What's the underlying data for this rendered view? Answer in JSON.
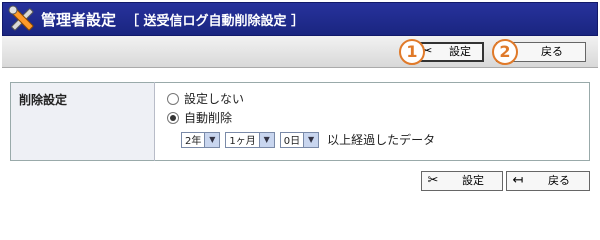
{
  "header": {
    "title": "管理者設定",
    "subtitle": "［ 送受信ログ自動削除設定 ］",
    "icon": "tools-icon"
  },
  "toolbar": {
    "set_label": "設定",
    "back_label": "戻る",
    "badge_1": "1",
    "badge_2": "2"
  },
  "form": {
    "row_label": "削除設定",
    "option_no": "設定しない",
    "option_auto": "自動削除",
    "selected_option": "自動削除",
    "year_value": "2年",
    "month_value": "1ヶ月",
    "day_value": "0日",
    "suffix": "以上経過したデータ"
  },
  "footer": {
    "set_label": "設定",
    "back_label": "戻る"
  },
  "colors": {
    "header_bg": "#1f2a8f",
    "badge": "#e07a2a"
  }
}
